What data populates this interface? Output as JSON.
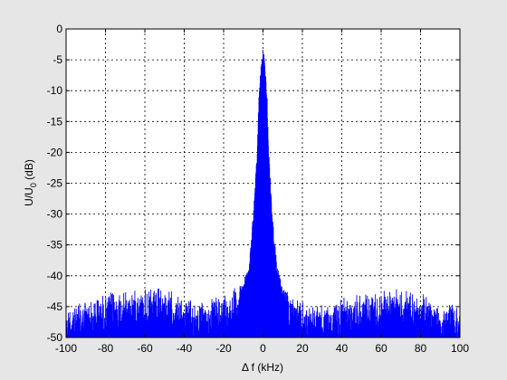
{
  "figure": {
    "background": "#e6e6e6",
    "axes_background": "#ffffff",
    "line_color": "#0000ff"
  },
  "chart_data": {
    "type": "line",
    "title": "",
    "xlabel": "Δ f (kHz)",
    "ylabel": {
      "main": "U/U",
      "sub": "0",
      "unit": " (dB)"
    },
    "xlim": [
      -100,
      100
    ],
    "ylim": [
      -50,
      0
    ],
    "xticks": [
      -100,
      -80,
      -60,
      -40,
      -20,
      0,
      20,
      40,
      60,
      80,
      100
    ],
    "yticks": [
      0,
      -5,
      -10,
      -15,
      -20,
      -25,
      -30,
      -35,
      -40,
      -45,
      -50
    ],
    "grid": true,
    "grid_style": "dotted",
    "series": [
      {
        "color": "#0000ff",
        "description_points": {
          "x": [
            -100,
            -90,
            -80,
            -70,
            -60,
            -50,
            -40,
            -30,
            -20,
            -15,
            -10,
            -7,
            -5,
            -3,
            -2,
            -1,
            -0.5,
            0,
            0.5,
            1,
            2,
            3,
            5,
            7,
            10,
            15,
            20,
            30,
            40,
            50,
            60,
            70,
            80,
            90,
            100
          ],
          "y_upper": [
            -46,
            -45,
            -44,
            -43.5,
            -43,
            -43.5,
            -44.5,
            -45.5,
            -44,
            -43,
            -41,
            -38,
            -30,
            -20,
            -10,
            -6,
            -4,
            -3.3,
            -4,
            -6,
            -10,
            -20,
            -31,
            -38,
            -42,
            -44,
            -45.5,
            -46,
            -45,
            -44,
            -43,
            -43,
            -44,
            -45.5,
            -46
          ],
          "y_lower": [
            -50,
            -50,
            -50,
            -50,
            -50,
            -50,
            -50,
            -50,
            -50,
            -50,
            -50,
            -50,
            -50,
            -50,
            -50,
            -50,
            -50,
            -50,
            -50,
            -50,
            -50,
            -50,
            -50,
            -50,
            -50,
            -50,
            -50,
            -50,
            -50,
            -50,
            -50,
            -50,
            -50,
            -50,
            -50
          ]
        }
      }
    ]
  }
}
